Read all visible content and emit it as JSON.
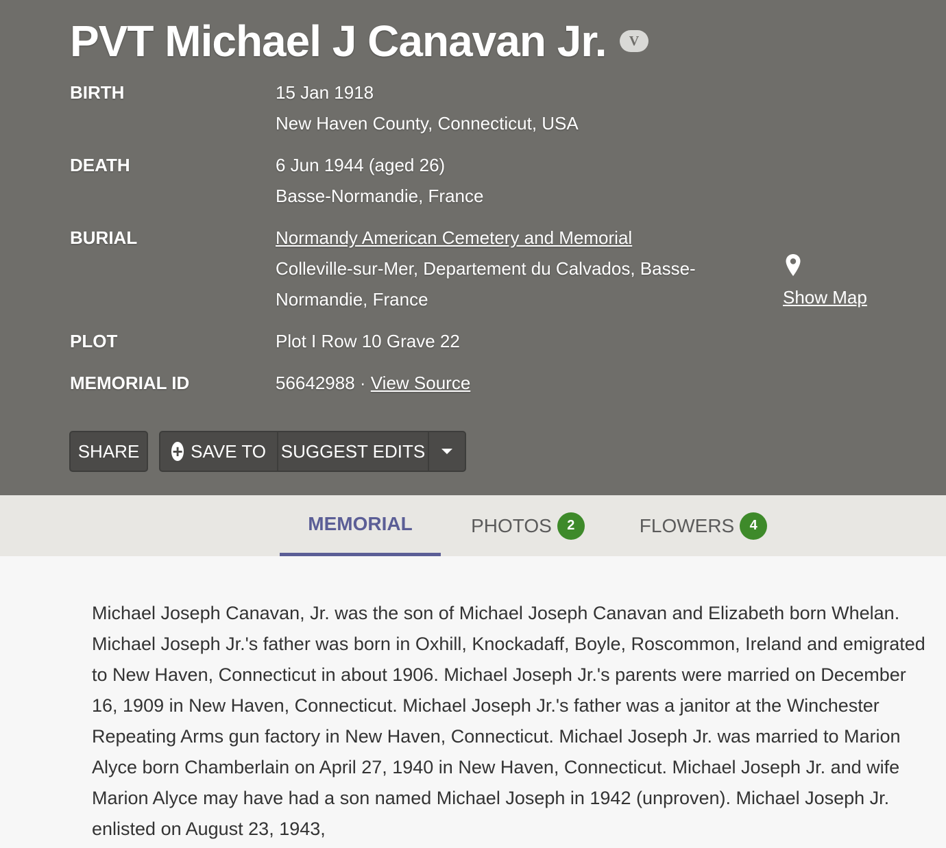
{
  "memorial": {
    "title": "PVT Michael J Canavan Jr.",
    "veteran_badge": "V",
    "facts": {
      "birth": {
        "label": "BIRTH",
        "date": "15 Jan 1918",
        "place": "New Haven County, Connecticut, USA"
      },
      "death": {
        "label": "DEATH",
        "date": "6 Jun 1944 (aged 26)",
        "place": "Basse-Normandie, France"
      },
      "burial": {
        "label": "BURIAL",
        "cemetery": "Normandy American Cemetery and Memorial",
        "place": "Colleville-sur-Mer, Departement du Calvados, Basse-Normandie, France"
      },
      "plot": {
        "label": "PLOT",
        "value": "Plot I Row 10 Grave 22"
      },
      "memorial_id": {
        "label": "MEMORIAL ID",
        "value": "56642988",
        "separator": " · ",
        "source_link": "View Source"
      }
    },
    "map": {
      "icon": "map-pin-icon",
      "label": "Show Map"
    },
    "actions": {
      "share": "SHARE",
      "save_to": "SAVE TO",
      "suggest_edits": "SUGGEST EDITS",
      "more_icon": "caret-down-icon"
    }
  },
  "tabs": [
    {
      "label": "MEMORIAL",
      "active": true
    },
    {
      "label": "PHOTOS",
      "count": "2"
    },
    {
      "label": "FLOWERS",
      "count": "4"
    }
  ],
  "bio": {
    "text": "Michael Joseph Canavan, Jr. was the son of Michael Joseph Canavan and Elizabeth born Whelan. Michael Joseph Jr.'s father was born in Oxhill, Knockadaff, Boyle, Roscommon, Ireland and emigrated to New Haven, Connecticut in about 1906. Michael Joseph Jr.'s parents were married on December 16, 1909 in New Haven, Connecticut. Michael Joseph Jr.'s father was a janitor at the Winchester Repeating Arms gun factory in New Haven, Connecticut. Michael Joseph Jr. was married to Marion Alyce born Chamberlain on April 27, 1940 in New Haven, Connecticut. Michael Joseph Jr. and wife Marion Alyce may have had a son named Michael Joseph in 1942 (unproven). Michael Joseph Jr. enlisted on August 23, 1943,"
  },
  "colors": {
    "header_bg": "#6f6e6a",
    "tab_active": "#5b5e96",
    "badge_green": "#3e8a2a"
  }
}
